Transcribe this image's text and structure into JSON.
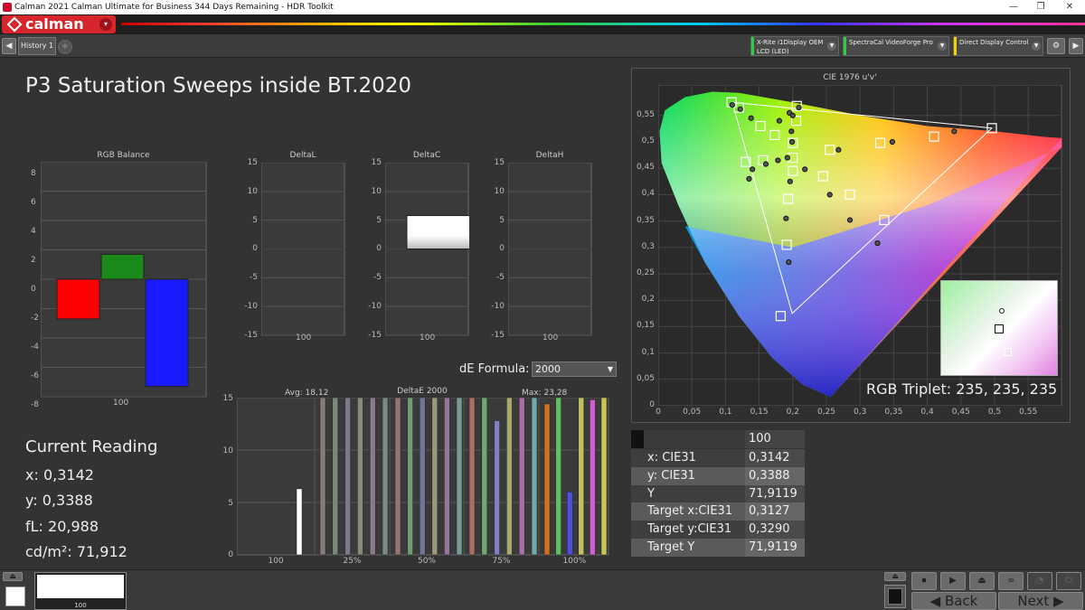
{
  "window": {
    "title": "Calman 2021 Calman Ultimate for Business 344 Days Remaining  - HDR Toolkit",
    "minimize": "—",
    "restore": "❐",
    "close": "✕"
  },
  "brand": {
    "logo": "calman",
    "menu_glyph": "▾"
  },
  "tabs": [
    {
      "label": "History 1"
    }
  ],
  "tab_add_glyph": "+",
  "nav_glyphs": {
    "left": "◀",
    "right": "▶",
    "gear": "⚙"
  },
  "devices": [
    {
      "line1": "X-Rite i1Display OEM",
      "line2": "LCD (LED)",
      "color": "#2ecc40"
    },
    {
      "line1": "SpectraCal VideoForge Pro",
      "line2": "",
      "color": "#2ecc40"
    },
    {
      "line1": "Direct Display Control",
      "line2": "",
      "color": "#f5d000"
    }
  ],
  "page_title": "P3 Saturation Sweeps inside BT.2020",
  "rgb_balance": {
    "title": "RGB Balance",
    "ylim": [
      -8,
      8
    ],
    "yticks": [
      "8",
      "6",
      "4",
      "2",
      "0",
      "-2",
      "-4",
      "-6",
      "-8"
    ],
    "category": "100",
    "values": {
      "red": -2.7,
      "green": 1.7,
      "blue": -7.3
    },
    "colors": {
      "red": "#ff0000",
      "green": "#1a8a1a",
      "blue": "#1a1aff"
    }
  },
  "delta_charts": [
    {
      "title": "DeltaL",
      "value": 0
    },
    {
      "title": "DeltaC",
      "value": 5.8
    },
    {
      "title": "DeltaH",
      "value": 0
    }
  ],
  "delta_ticks": [
    "15",
    "10",
    "5",
    "0",
    "-5",
    "-10",
    "-15"
  ],
  "delta_category": "100",
  "de_formula": {
    "label": "dE Formula:",
    "value": "2000",
    "arrow": "▼"
  },
  "deltae_chart": {
    "title": "DeltaE 2000",
    "avg_label": "Avg: 18,12",
    "max_label": "Max: 23,28",
    "ylim": [
      0,
      15
    ],
    "yticks": [
      "15",
      "10",
      "5",
      "0"
    ],
    "groups": [
      {
        "label": "100",
        "bars": [
          {
            "v": 6.3,
            "c": "#ffffff"
          }
        ]
      },
      {
        "label": "25%",
        "bars": [
          {
            "v": 15,
            "c": "#8a7a78"
          },
          {
            "v": 15,
            "c": "#7a8a7a"
          },
          {
            "v": 15,
            "c": "#7a7a8a"
          },
          {
            "v": 15,
            "c": "#8a8a7a"
          },
          {
            "v": 15,
            "c": "#8a7a8a"
          },
          {
            "v": 15,
            "c": "#7a8a8a"
          }
        ]
      },
      {
        "label": "50%",
        "bars": [
          {
            "v": 15,
            "c": "#9a7470"
          },
          {
            "v": 15,
            "c": "#749a74"
          },
          {
            "v": 15,
            "c": "#74749a"
          },
          {
            "v": 15,
            "c": "#9a9a74"
          },
          {
            "v": 15,
            "c": "#9a749a"
          },
          {
            "v": 15,
            "c": "#749a9a"
          }
        ]
      },
      {
        "label": "75%",
        "bars": [
          {
            "v": 15,
            "c": "#a87060"
          },
          {
            "v": 15,
            "c": "#70a870"
          },
          {
            "v": 12.8,
            "c": "#8080c0"
          },
          {
            "v": 15,
            "c": "#a8a870"
          },
          {
            "v": 15,
            "c": "#a870a8"
          },
          {
            "v": 15,
            "c": "#70a8a8"
          }
        ]
      },
      {
        "label": "100%",
        "bars": [
          {
            "v": 14.4,
            "c": "#d07020"
          },
          {
            "v": 15,
            "c": "#60c060"
          },
          {
            "v": 6.0,
            "c": "#5050e0"
          },
          {
            "v": 15,
            "c": "#c0c060"
          },
          {
            "v": 14.8,
            "c": "#d060d0"
          },
          {
            "v": 15,
            "c": "#c8c850"
          }
        ]
      }
    ]
  },
  "cie": {
    "title": "CIE 1976 u'v'",
    "xticks": [
      "0",
      "0,05",
      "0,1",
      "0,15",
      "0,2",
      "0,25",
      "0,3",
      "0,35",
      "0,4",
      "0,45",
      "0,5",
      "0,55"
    ],
    "yticks": [
      "0,55",
      "0,5",
      "0,45",
      "0,4",
      "0,35",
      "0,3",
      "0,25",
      "0,2",
      "0,15",
      "0,1",
      "0,05",
      "0"
    ],
    "xlim": [
      0,
      0.6
    ],
    "ylim": [
      0,
      0.6
    ],
    "gamut_triangle": [
      [
        0.11,
        0.575
      ],
      [
        0.496,
        0.526
      ],
      [
        0.199,
        0.175
      ]
    ],
    "targets": [
      [
        0.109,
        0.575
      ],
      [
        0.12,
        0.565
      ],
      [
        0.152,
        0.53
      ],
      [
        0.173,
        0.513
      ],
      [
        0.2,
        0.498
      ],
      [
        0.206,
        0.568
      ],
      [
        0.205,
        0.54
      ],
      [
        0.33,
        0.498
      ],
      [
        0.41,
        0.51
      ],
      [
        0.496,
        0.526
      ],
      [
        0.255,
        0.485
      ],
      [
        0.13,
        0.462
      ],
      [
        0.156,
        0.465
      ],
      [
        0.2,
        0.445
      ],
      [
        0.245,
        0.435
      ],
      [
        0.193,
        0.392
      ],
      [
        0.285,
        0.4
      ],
      [
        0.336,
        0.352
      ],
      [
        0.191,
        0.305
      ],
      [
        0.182,
        0.17
      ],
      [
        0.2,
        0.47
      ]
    ],
    "measured": [
      [
        0.11,
        0.57
      ],
      [
        0.122,
        0.562
      ],
      [
        0.138,
        0.545
      ],
      [
        0.18,
        0.54
      ],
      [
        0.195,
        0.555
      ],
      [
        0.2,
        0.55
      ],
      [
        0.209,
        0.565
      ],
      [
        0.348,
        0.5
      ],
      [
        0.44,
        0.52
      ],
      [
        0.268,
        0.485
      ],
      [
        0.135,
        0.43
      ],
      [
        0.14,
        0.448
      ],
      [
        0.16,
        0.458
      ],
      [
        0.178,
        0.465
      ],
      [
        0.196,
        0.425
      ],
      [
        0.218,
        0.448
      ],
      [
        0.19,
        0.355
      ],
      [
        0.255,
        0.4
      ],
      [
        0.285,
        0.352
      ],
      [
        0.326,
        0.308
      ],
      [
        0.194,
        0.272
      ],
      [
        0.192,
        0.47
      ],
      [
        0.199,
        0.5
      ],
      [
        0.198,
        0.52
      ]
    ],
    "triplet_label": "RGB Triplet: 235, 235, 235"
  },
  "current_reading": {
    "title": "Current Reading",
    "x": "x: 0,3142",
    "y": "y: 0,3388",
    "fl": "fL: 20,988",
    "cdm2": "cd/m²: 71,912"
  },
  "readings_table": {
    "header": "100",
    "rows": [
      {
        "label": "x: CIE31",
        "value": "0,3142"
      },
      {
        "label": "y: CIE31",
        "value": "0,3388"
      },
      {
        "label": "Y",
        "value": "71,9119"
      },
      {
        "label": "Target x:CIE31",
        "value": "0,3127"
      },
      {
        "label": "Target y:CIE31",
        "value": "0,3290"
      },
      {
        "label": "Target Y",
        "value": "71,9119"
      }
    ]
  },
  "bottom": {
    "swatch_label": "100",
    "back_label": "Back",
    "next_label": "Next",
    "eject_glyph": "⏏",
    "icons": [
      "⏹",
      "▶",
      "⏏",
      "∞",
      "◔",
      "⏻"
    ]
  }
}
